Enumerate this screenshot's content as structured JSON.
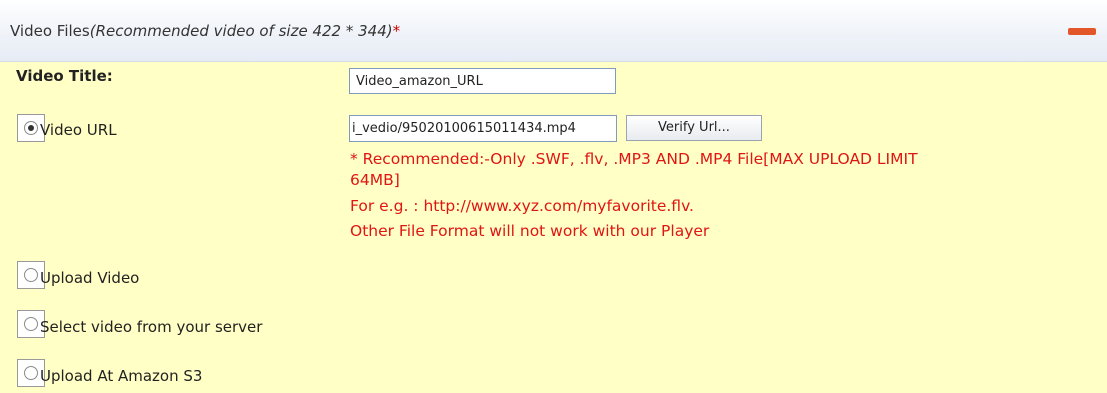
{
  "header": {
    "title": "Video Files",
    "subtitle": "(Recommended video of size 422 * 344)",
    "required_mark": "*"
  },
  "form": {
    "video_title_label": "Video Title:",
    "video_title_value": "Video_amazon_URL",
    "video_url_label": "Video URL",
    "video_url_value": "i_vedio/95020100615011434.mp4",
    "verify_button_label": "Verify Url...",
    "notes": {
      "line1": "* Recommended:-Only .SWF, .flv, .MP3 AND .MP4 File[MAX UPLOAD LIMIT",
      "line2": "64MB]",
      "line3": "For e.g. : http://www.xyz.com/myfavorite.flv.",
      "line4": "Other File Format will not work with our Player"
    },
    "options": {
      "upload_video": "Upload Video",
      "select_from_server": "Select video from your server",
      "upload_amazon_s3": "Upload At Amazon S3"
    },
    "selected_option": "video_url"
  },
  "colors": {
    "panel_bg": "#ffffc6",
    "note_text": "#e01515",
    "collapse_icon": "#e2562a"
  },
  "icons": {
    "collapse": "minus-icon"
  }
}
